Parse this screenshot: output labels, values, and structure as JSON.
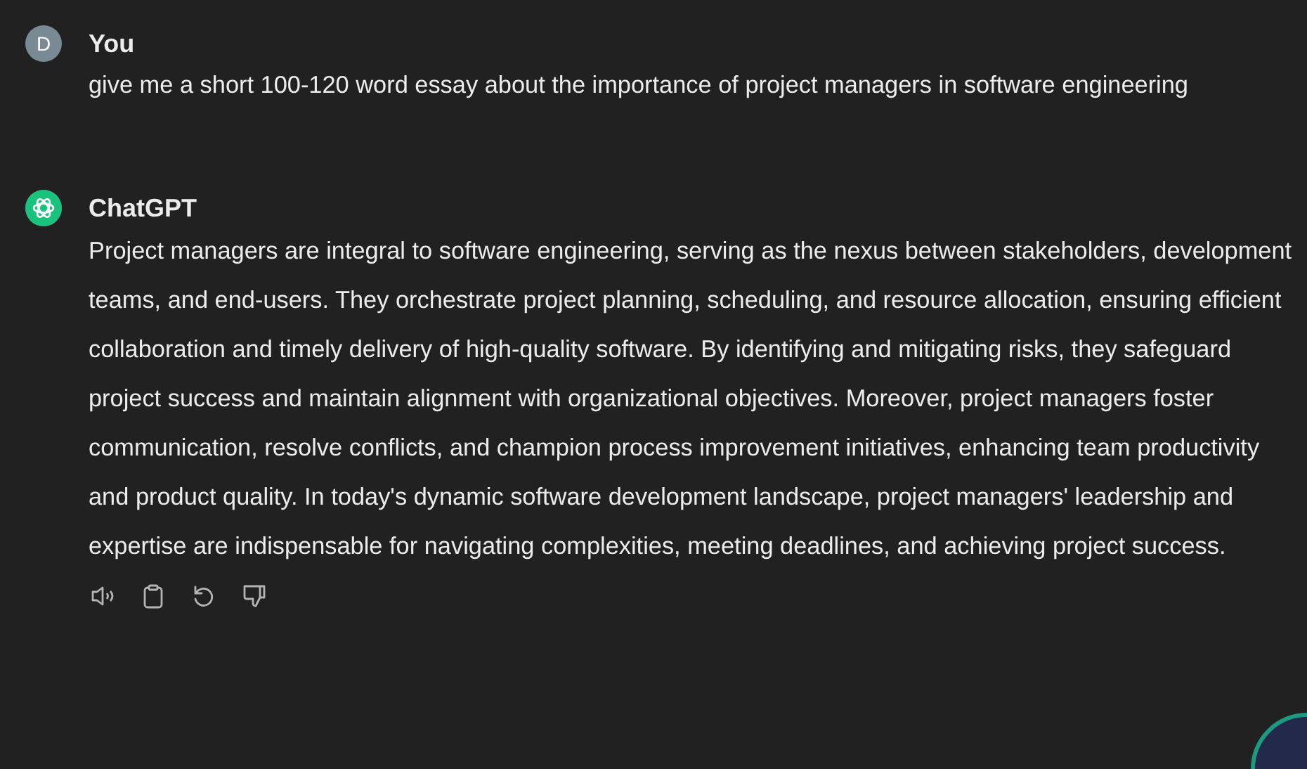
{
  "messages": [
    {
      "kind": "user",
      "author": "You",
      "avatar": "D",
      "text": "give me a short 100-120 word essay about the importance of project managers in software engineering"
    },
    {
      "kind": "assistant",
      "author": "ChatGPT",
      "text": "Project managers are integral to software engineering, serving as the nexus between stakeholders, development teams, and end-users. They orchestrate project planning, scheduling, and resource allocation, ensuring efficient collaboration and timely delivery of high-quality software. By identifying and mitigating risks, they safeguard project success and maintain alignment with organizational objectives. Moreover, project managers foster communication, resolve conflicts, and champion process improvement initiatives, enhancing team productivity and product quality. In today's dynamic software development landscape, project managers' leadership and expertise are indispensable for navigating complexities, meeting deadlines, and achieving project success."
    }
  ]
}
